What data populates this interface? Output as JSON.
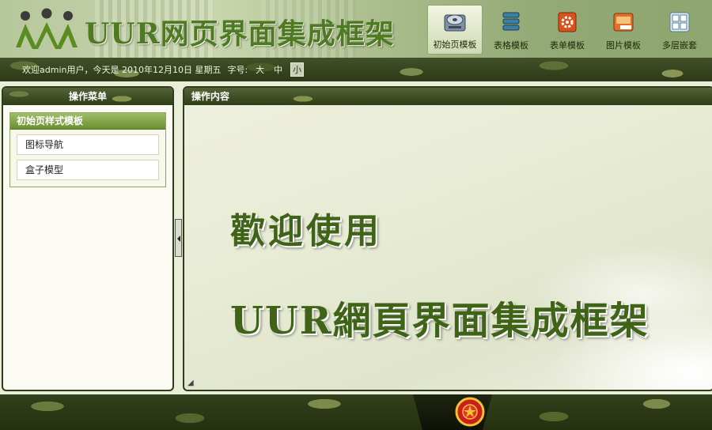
{
  "header": {
    "logo_text": "UUR网页界面集成框架",
    "nav": [
      {
        "label": "初始页模板",
        "icon": "disk-icon",
        "active": true
      },
      {
        "label": "表格模板",
        "icon": "database-icon",
        "active": false
      },
      {
        "label": "表单模板",
        "icon": "gear-icon",
        "active": false
      },
      {
        "label": "图片模板",
        "icon": "png-image-icon",
        "active": false
      },
      {
        "label": "多层嵌套",
        "icon": "grid-window-icon",
        "active": false
      }
    ]
  },
  "infobar": {
    "greeting": "欢迎admin用户，今天是 2010年12月10日 星期五",
    "font_size_label": "字号:",
    "font_sizes": [
      "大",
      "中",
      "小"
    ],
    "selected_size": "小"
  },
  "sidebar": {
    "title": "操作菜单",
    "group_title": "初始页样式模板",
    "items": [
      "图标导航",
      "盒子模型"
    ]
  },
  "main": {
    "title": "操作内容",
    "welcome_line1": "歡迎使用",
    "welcome_line2": "UUR網頁界面集成框架"
  },
  "colors": {
    "accent_green": "#4e7a22",
    "camo_dark": "#2f3d18",
    "menu_header_green": "#6b8f32"
  }
}
